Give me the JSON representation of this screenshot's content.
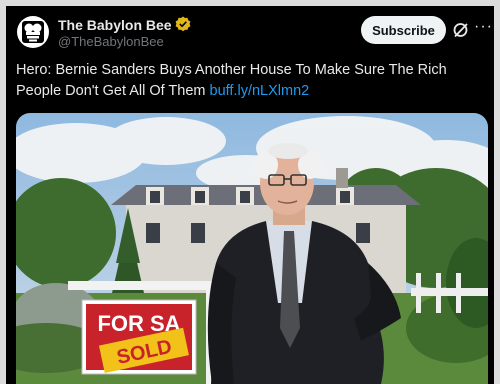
{
  "post": {
    "author_name": "The Babylon Bee",
    "handle": "@TheBabylonBee",
    "subscribe_label": "Subscribe",
    "text": "Hero: Bernie Sanders Buys Another House To Make Sure The Rich People Don't Get All Of Them",
    "link": "buff.ly/nLXlmn2",
    "more_label": "···"
  },
  "image": {
    "sign_top": "FOR SA",
    "sign_sticker": "SOLD"
  },
  "colors": {
    "background": "#000000",
    "text": "#e7e9ea",
    "muted": "#71767b",
    "link": "#1d9bf0",
    "verified": "#e2b719",
    "sign_red": "#c8232b",
    "sticker_yellow": "#f2c21a"
  },
  "icons": {
    "avatar": "babylon-bee-logo",
    "verified": "gold-checkmark-badge",
    "grok": "grok-icon",
    "more": "more-horizontal-icon"
  }
}
